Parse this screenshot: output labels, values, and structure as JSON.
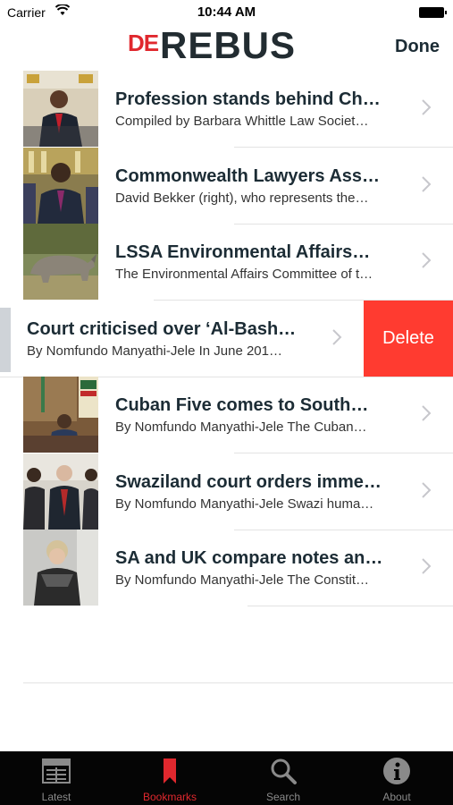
{
  "status_bar": {
    "carrier": "Carrier",
    "time": "10:44 AM"
  },
  "nav": {
    "logo_prefix": "DE",
    "logo_main": "REBUS",
    "done_label": "Done"
  },
  "articles": [
    {
      "title": "Profession stands behind Ch…",
      "subtitle": "Compiled by Barbara Whittle Law Societ…"
    },
    {
      "title": "Commonwealth Lawyers Ass…",
      "subtitle": "David Bekker (right), who represents the…"
    },
    {
      "title": "LSSA Environmental Affairs…",
      "subtitle": "The Environmental Affairs Committee of t…"
    },
    {
      "title": "Court criticised over ‘Al-Bash…",
      "subtitle": "By Nomfundo Manyathi-Jele In June 201…"
    },
    {
      "title": "Cuban Five comes to South…",
      "subtitle": "By Nomfundo Manyathi-Jele The Cuban…"
    },
    {
      "title": "Swaziland court orders imme…",
      "subtitle": "By Nomfundo Manyathi-Jele Swazi huma…"
    },
    {
      "title": "SA and UK compare notes an…",
      "subtitle": "By Nomfundo Manyathi-Jele The Constit…"
    }
  ],
  "delete_label": "Delete",
  "tabs": [
    {
      "label": "Latest",
      "icon": "newspaper-icon"
    },
    {
      "label": "Bookmarks",
      "icon": "bookmark-icon",
      "active": true
    },
    {
      "label": "Search",
      "icon": "search-icon"
    },
    {
      "label": "About",
      "icon": "info-icon"
    }
  ],
  "colors": {
    "brand_red": "#e0282e",
    "delete_red": "#ff3b30",
    "tab_bar": "#050505"
  }
}
